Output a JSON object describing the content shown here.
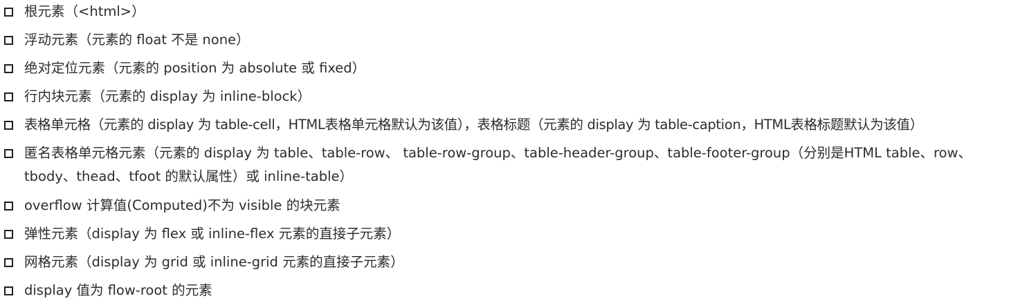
{
  "list": {
    "items": [
      {
        "text": "根元素（<html>）"
      },
      {
        "text": "浮动元素（元素的 float 不是 none）"
      },
      {
        "text": "绝对定位元素（元素的 position 为 absolute 或 fixed）"
      },
      {
        "text": "行内块元素（元素的 display 为 inline-block）"
      },
      {
        "text": "表格单元格（元素的 display 为 table-cell，HTML表格单元格默认为该值），表格标题（元素的 display 为 table-caption，HTML表格标题默认为该值）"
      },
      {
        "text": "匿名表格单元格元素（元素的 display 为 table、table-row、 table-row-group、table-header-group、table-footer-group（分别是HTML table、row、tbody、thead、tfoot 的默认属性）或 inline-table）"
      },
      {
        "text": "overflow 计算值(Computed)不为 visible 的块元素"
      },
      {
        "text": "弹性元素（display 为 flex 或 inline-flex 元素的直接子元素）"
      },
      {
        "text": "网格元素（display 为 grid 或 inline-grid 元素的直接子元素）"
      },
      {
        "text": "display 值为 flow-root 的元素"
      }
    ]
  }
}
